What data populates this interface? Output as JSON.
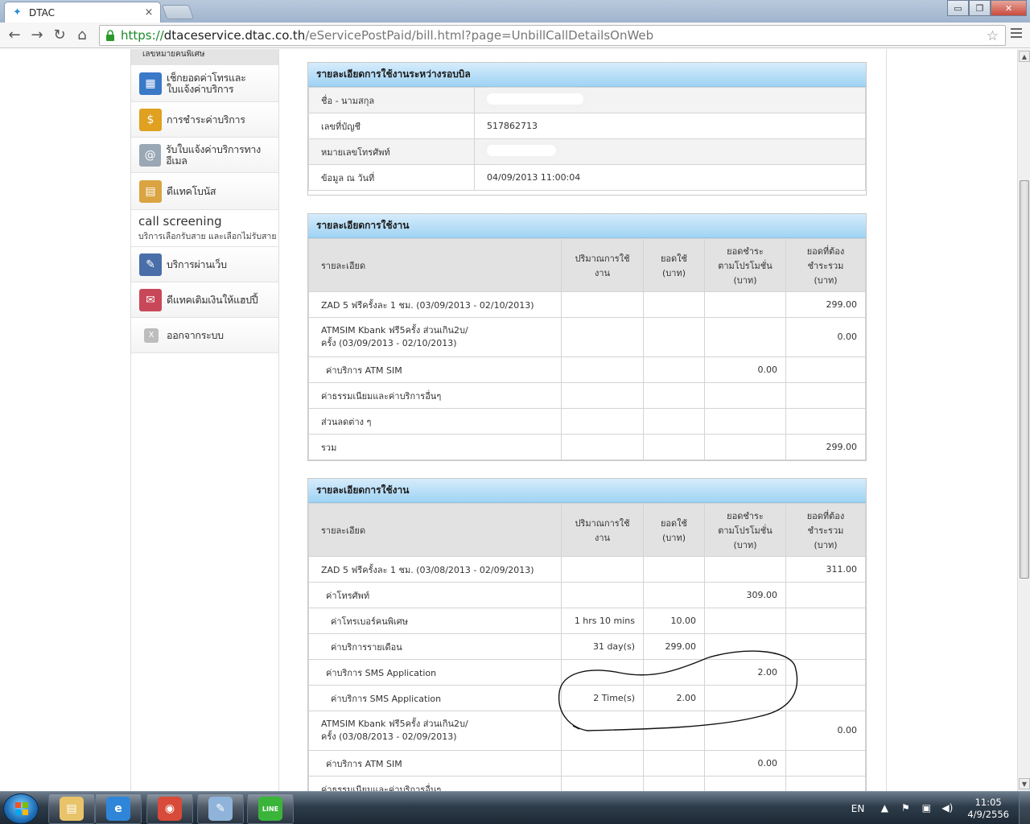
{
  "browser": {
    "tab_title": "DTAC",
    "tab_close": "×",
    "url_scheme": "https://",
    "url_host": "dtaceservice.dtac.co.th",
    "url_path": "/eServicePostPaid/bill.html?page=UnbillCallDetailsOnWeb",
    "window_controls": {
      "minimize": "▭",
      "maximize": "❐",
      "close": "✕"
    },
    "nav": {
      "back": "←",
      "forward": "→",
      "reload": "↻",
      "home": "⌂",
      "star": "☆"
    }
  },
  "sidebar": {
    "top_label": "เลขหมายคนพิเศษ",
    "items": [
      {
        "label_line1": "เช็กยอดค่าโทรและ",
        "label_line2": "ใบแจ้งค่าบริการ",
        "icon": "bill-icon",
        "color": "#3a78c8"
      },
      {
        "label_line1": "การชำระค่าบริการ",
        "label_line2": "",
        "icon": "payment-icon",
        "color": "#e0a020"
      },
      {
        "label_line1": "รับใบแจ้งค่าบริการทางอีเมล",
        "label_line2": "",
        "icon": "email-icon",
        "color": "#9aa7b4"
      },
      {
        "label_line1": "ดีแทคโบนัส",
        "label_line2": "",
        "icon": "bonus-icon",
        "color": "#d9a441"
      }
    ],
    "call_screening": {
      "title": "call screening",
      "subtitle": "บริการเลือกรับสาย และเลือกไม่รับสาย"
    },
    "items2": [
      {
        "label_line1": "บริการผ่านเว็บ",
        "icon": "web-service-icon",
        "color": "#4a6fa8"
      },
      {
        "label_line1": "ดีแทคเติมเงินให้แฮปปี้",
        "icon": "topup-icon",
        "color": "#c8485a"
      },
      {
        "label_line1": "ออกจากระบบ",
        "icon": "logout-icon",
        "color": "#bdbdbd",
        "glyph": "X"
      }
    ]
  },
  "account_panel": {
    "title": "รายละเอียดการใช้งานระหว่างรอบบิล",
    "rows": [
      {
        "label": "ชื่อ - นามสกุล",
        "value": ""
      },
      {
        "label": "เลขที่บัญชี",
        "value": "517862713"
      },
      {
        "label": "หมายเลขโทรศัพท์",
        "value": ""
      },
      {
        "label": "ข้อมูล ณ วันที่",
        "value": "04/09/2013 11:00:04"
      }
    ]
  },
  "usage_headers": {
    "desc": "รายละเอียด",
    "qty_l1": "ปริมาณการใช้",
    "qty_l2": "งาน",
    "used_l1": "ยอดใช้",
    "used_l2": "(บาท)",
    "promo_l1": "ยอดชำระ",
    "promo_l2": "ตามโปรโมชั่น",
    "promo_l3": "(บาท)",
    "total_l1": "ยอดที่ต้อง",
    "total_l2": "ชำระรวม",
    "total_l3": "(บาท)"
  },
  "usage_panel_1": {
    "title": "รายละเอียดการใช้งาน",
    "rows": [
      {
        "desc": "ZAD 5 ฟรีครั้งละ 1 ชม. (03/09/2013 - 02/10/2013)",
        "qty": "",
        "used": "",
        "promo": "",
        "total": "299.00",
        "indent": 0
      },
      {
        "desc": "ATMSIM Kbank ฟรี5ครั้ง ส่วนเกิน2บ/",
        "desc2": "ครั้ง (03/09/2013 - 02/10/2013)",
        "qty": "",
        "used": "",
        "promo": "",
        "total": "0.00",
        "indent": 0,
        "tall": true
      },
      {
        "desc": "ค่าบริการ ATM SIM",
        "qty": "",
        "used": "",
        "promo": "0.00",
        "total": "",
        "indent": 1
      },
      {
        "desc": "ค่าธรรมเนียมและค่าบริการอื่นๆ",
        "qty": "",
        "used": "",
        "promo": "",
        "total": "",
        "indent": 0
      },
      {
        "desc": "ส่วนลดต่าง ๆ",
        "qty": "",
        "used": "",
        "promo": "",
        "total": "",
        "indent": 0
      },
      {
        "desc": "รวม",
        "qty": "",
        "used": "",
        "promo": "",
        "total": "299.00",
        "indent": 0
      }
    ]
  },
  "usage_panel_2": {
    "title": "รายละเอียดการใช้งาน",
    "rows": [
      {
        "desc": "ZAD 5 ฟรีครั้งละ 1 ชม. (03/08/2013 - 02/09/2013)",
        "qty": "",
        "used": "",
        "promo": "",
        "total": "311.00",
        "indent": 0
      },
      {
        "desc": "ค่าโทรศัพท์",
        "qty": "",
        "used": "",
        "promo": "309.00",
        "total": "",
        "indent": 1
      },
      {
        "desc": "ค่าโทรเบอร์คนพิเศษ",
        "qty": "1 hrs 10 mins",
        "used": "10.00",
        "promo": "",
        "total": "",
        "indent": 2
      },
      {
        "desc": "ค่าบริการรายเดือน",
        "qty": "31 day(s)",
        "used": "299.00",
        "promo": "",
        "total": "",
        "indent": 2
      },
      {
        "desc": "ค่าบริการ SMS Application",
        "qty": "",
        "used": "",
        "promo": "2.00",
        "total": "",
        "indent": 1
      },
      {
        "desc": "ค่าบริการ SMS Application",
        "qty": "2 Time(s)",
        "used": "2.00",
        "promo": "",
        "total": "",
        "indent": 2
      },
      {
        "desc": "ATMSIM Kbank ฟรี5ครั้ง ส่วนเกิน2บ/",
        "desc2": "ครั้ง (03/08/2013 - 02/09/2013)",
        "qty": "",
        "used": "",
        "promo": "",
        "total": "0.00",
        "indent": 0,
        "tall": true
      },
      {
        "desc": "ค่าบริการ ATM SIM",
        "qty": "",
        "used": "",
        "promo": "0.00",
        "total": "",
        "indent": 1
      },
      {
        "desc": "ค่าธรรมเนียมและค่าบริการอื่นๆ",
        "qty": "",
        "used": "",
        "promo": "",
        "total": "",
        "indent": 0
      }
    ]
  },
  "taskbar": {
    "apps": [
      {
        "name": "explorer",
        "color": "#e8c36a",
        "glyph": "▤"
      },
      {
        "name": "internet-explorer",
        "color": "#2f86d8",
        "glyph": "e"
      },
      {
        "name": "chrome",
        "color": "#d84a3a",
        "glyph": "◉"
      },
      {
        "name": "paint",
        "color": "#8fb3d9",
        "glyph": "✎"
      },
      {
        "name": "line",
        "color": "#3ab53a",
        "glyph": "LINE"
      }
    ],
    "lang": "EN",
    "time": "11:05",
    "date": "4/9/2556"
  }
}
